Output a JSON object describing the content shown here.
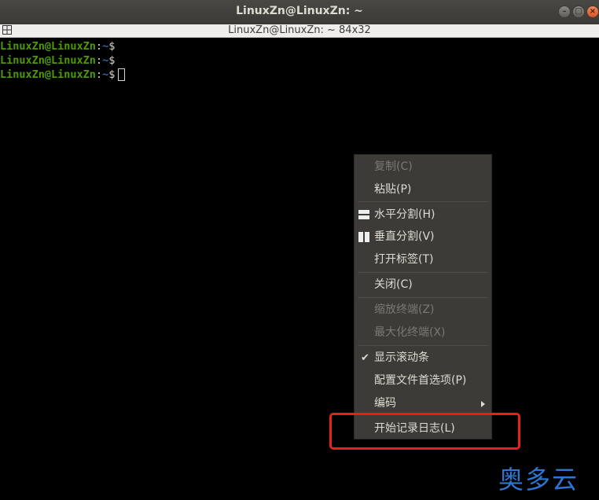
{
  "window": {
    "title": "LinuxZn@LinuxZn: ~"
  },
  "terminal": {
    "header": "LinuxZn@LinuxZn: ~ 84x32",
    "lines": [
      {
        "user": "LinuxZn@LinuxZn",
        "colon": ":",
        "path": "~",
        "prompt": "$"
      },
      {
        "user": "LinuxZn@LinuxZn",
        "colon": ":",
        "path": "~",
        "prompt": "$"
      },
      {
        "user": "LinuxZn@LinuxZn",
        "colon": ":",
        "path": "~",
        "prompt": "$"
      }
    ]
  },
  "menu": {
    "items": [
      {
        "label": "复制(C)",
        "enabled": false
      },
      {
        "label": "粘贴(P)",
        "enabled": true
      },
      {
        "label": "水平分割(H)",
        "enabled": true,
        "icon": "split-horizontal-icon"
      },
      {
        "label": "垂直分割(V)",
        "enabled": true,
        "icon": "split-vertical-icon"
      },
      {
        "label": "打开标签(T)",
        "enabled": true
      },
      {
        "label": "关闭(C)",
        "enabled": true
      },
      {
        "label": "缩放终端(Z)",
        "enabled": false
      },
      {
        "label": "最大化终端(X)",
        "enabled": false
      },
      {
        "label": "显示滚动条",
        "enabled": true,
        "checked": true
      },
      {
        "label": "配置文件首选项(P)",
        "enabled": true
      },
      {
        "label": "编码",
        "enabled": true,
        "submenu": true
      },
      {
        "label": "开始记录日志(L)",
        "enabled": true
      }
    ]
  },
  "watermark": "奥多云",
  "colors": {
    "highlight_box": "#e8201a",
    "prompt_user": "#4e9a06",
    "prompt_path": "#3465a4"
  }
}
